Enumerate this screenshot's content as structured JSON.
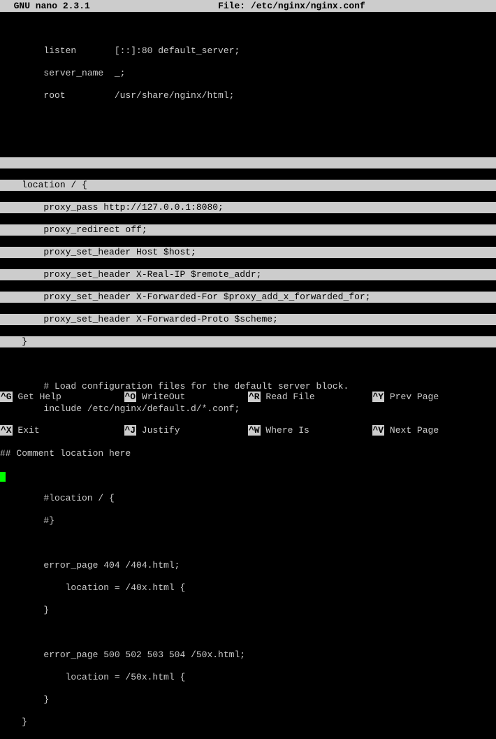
{
  "titlebar": {
    "left": "  GNU nano 2.3.1",
    "file_label": "File:",
    "file_path": "/etc/nginx/nginx.conf"
  },
  "lines": {
    "l1": "        listen       [::]:80 default_server;",
    "l2": "        server_name  _;",
    "l3": "        root         /usr/share/nginx/html;",
    "h1": "                                                                                    ",
    "h2": "    location / {                                                                    ",
    "h3": "        proxy_pass http://127.0.0.1:8080;                                           ",
    "h4": "        proxy_redirect off;                                                         ",
    "h5": "        proxy_set_header Host $host;                                                ",
    "h6": "        proxy_set_header X-Real-IP $remote_addr;                                    ",
    "h7": "        proxy_set_header X-Forwarded-For $proxy_add_x_forwarded_for;                ",
    "h8": "        proxy_set_header X-Forwarded-Proto $scheme;                                 ",
    "h9": "    }                                                                               ",
    "c1": "        # Load configuration files for the default server block.",
    "c2": "        include /etc/nginx/default.d/*.conf;",
    "c3": "## Comment location here",
    "c4": "        #location / {",
    "c5": "        #}",
    "c6": "        error_page 404 /404.html;",
    "c7": "            location = /40x.html {",
    "c8": "        }",
    "c9": "        error_page 500 502 503 504 /50x.html;",
    "c10": "            location = /50x.html {",
    "c11": "        }",
    "c12": "    }"
  },
  "footer": {
    "r1c1_key": "^G",
    "r1c1_label": " Get Help",
    "r1c2_key": "^O",
    "r1c2_label": " WriteOut",
    "r1c3_key": "^R",
    "r1c3_label": " Read File",
    "r1c4_key": "^Y",
    "r1c4_label": " Prev Page",
    "r2c1_key": "^X",
    "r2c1_label": " Exit",
    "r2c2_key": "^J",
    "r2c2_label": " Justify",
    "r2c3_key": "^W",
    "r2c3_label": " Where Is",
    "r2c4_key": "^V",
    "r2c4_label": " Next Page"
  }
}
